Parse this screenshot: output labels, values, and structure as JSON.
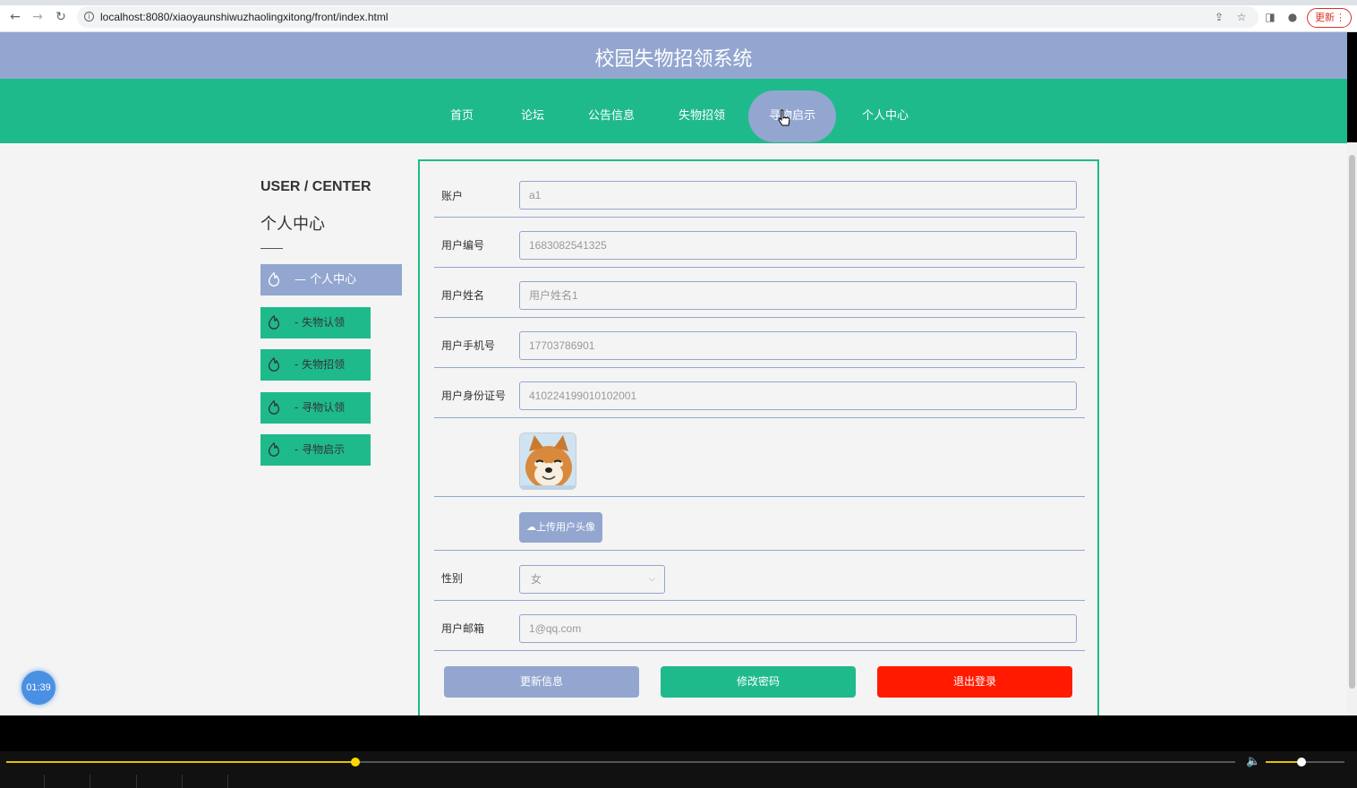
{
  "browser": {
    "url": "localhost:8080/xiaoyaunshiwuzhaolingxitong/front/index.html",
    "update_label": "更新"
  },
  "site": {
    "title": "校园失物招领系统",
    "nav": [
      {
        "label": "首页"
      },
      {
        "label": "论坛"
      },
      {
        "label": "公告信息"
      },
      {
        "label": "失物招领"
      },
      {
        "label": "寻物启示"
      },
      {
        "label": "个人中心"
      }
    ],
    "active_nav_index": 4
  },
  "sidebar": {
    "title_en": "USER / CENTER",
    "title_cn": "个人中心",
    "items": [
      {
        "label": "— 个人中心",
        "active": true
      },
      {
        "label": "- 失物认领"
      },
      {
        "label": "- 失物招领"
      },
      {
        "label": "- 寻物认领"
      },
      {
        "label": "- 寻物启示"
      }
    ]
  },
  "form": {
    "fields": [
      {
        "label": "账户",
        "value": "a1"
      },
      {
        "label": "用户编号",
        "value": "1683082541325"
      },
      {
        "label": "用户姓名",
        "value": "用户姓名1"
      },
      {
        "label": "用户手机号",
        "value": "17703786901"
      },
      {
        "label": "用户身份证号",
        "value": "410224199010102001"
      }
    ],
    "upload_label": "上传用户头像",
    "gender_label": "性别",
    "gender_value": "女",
    "email_label": "用户邮箱",
    "email_value": "1@qq.com",
    "buttons": {
      "update": "更新信息",
      "change_password": "修改密码",
      "logout": "退出登录"
    }
  },
  "timer": "01:39",
  "player": {
    "progress": 0.284,
    "volume": 0.45
  },
  "colors": {
    "header": "#93a6d0",
    "nav": "#1fba8c",
    "logout": "#ff1a00"
  }
}
